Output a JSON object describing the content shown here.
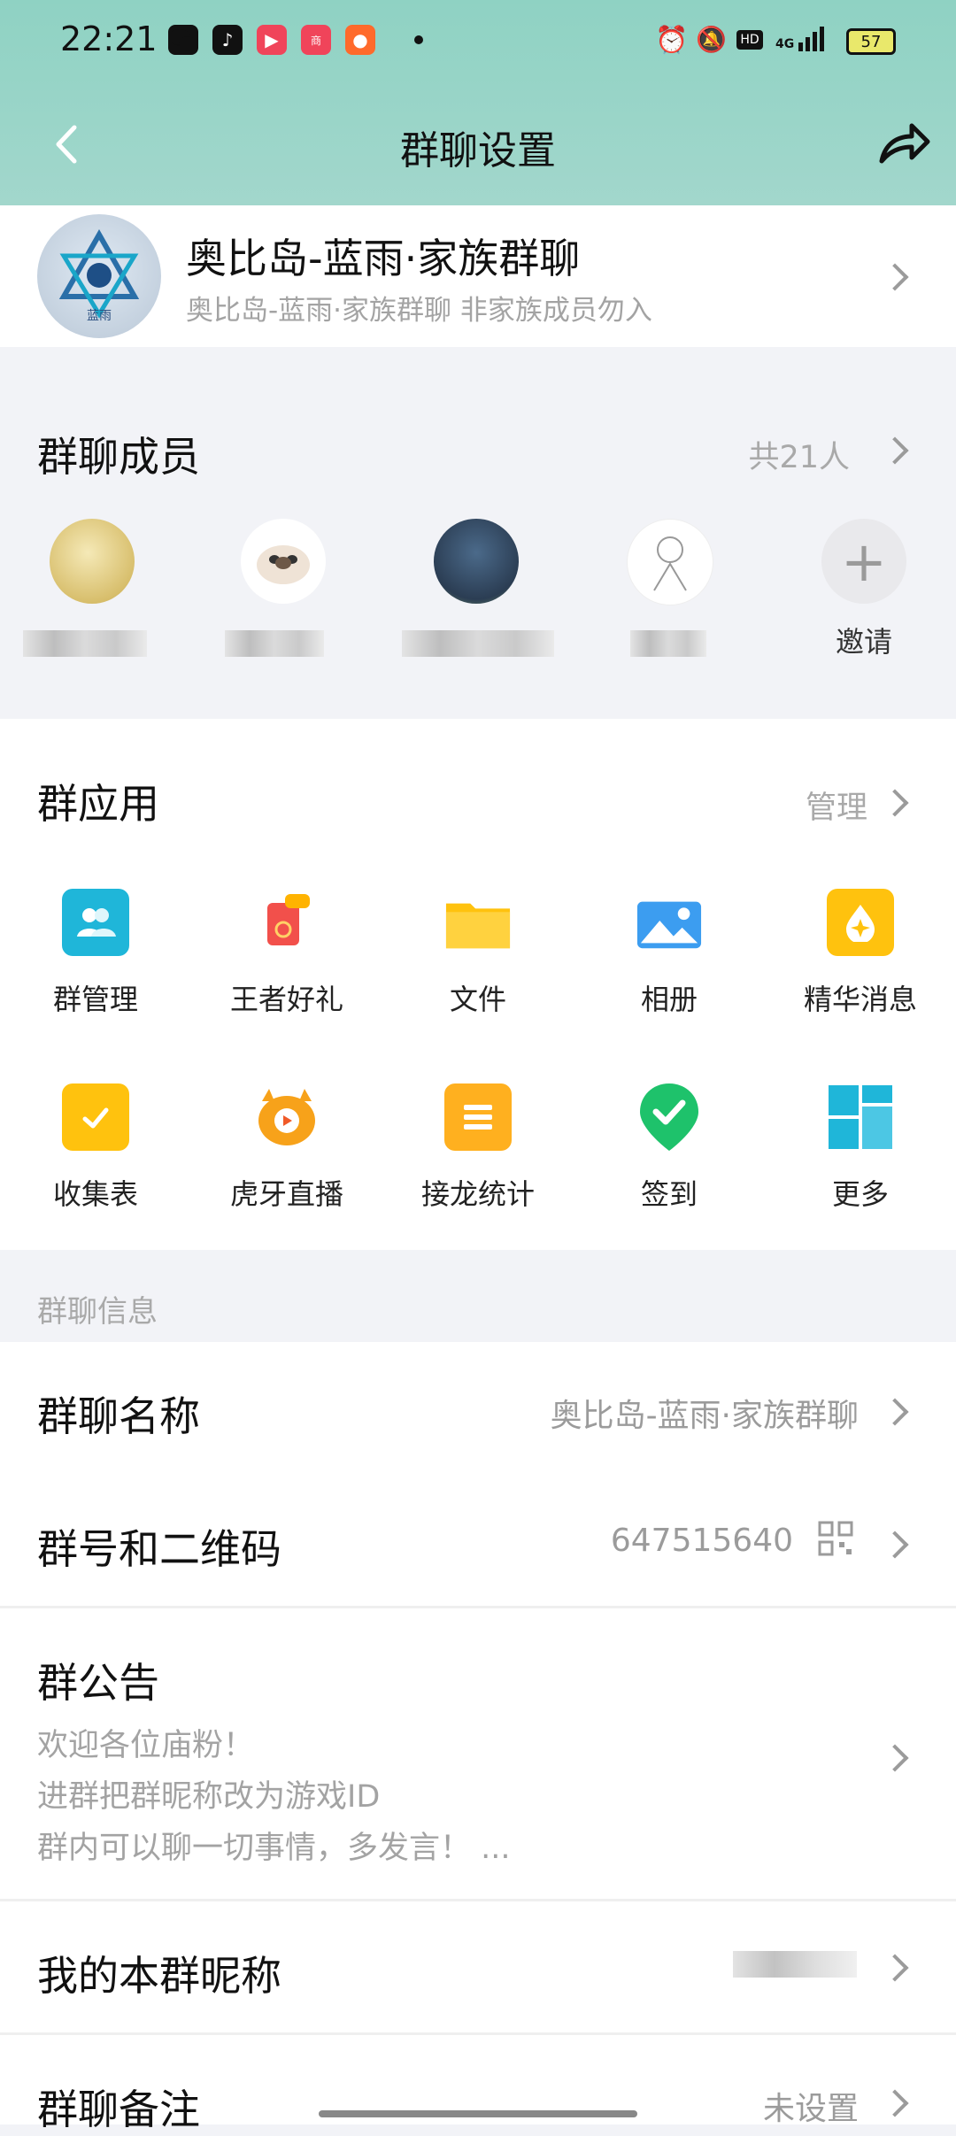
{
  "status_bar": {
    "time": "22:21",
    "battery": "57",
    "network": "4G"
  },
  "nav": {
    "title": "群聊设置"
  },
  "group": {
    "name": "奥比岛-蓝雨·家族群聊",
    "subtitle": "奥比岛-蓝雨·家族群聊 非家族成员勿入",
    "avatar_text": "蓝雨"
  },
  "members": {
    "title": "群聊成员",
    "count": "共21人",
    "invite_label": "邀请"
  },
  "apps": {
    "title": "群应用",
    "manage": "管理",
    "items": [
      {
        "label": "群管理",
        "icon": "group-manage-icon",
        "color": "#1fb6d9"
      },
      {
        "label": "王者好礼",
        "icon": "gift-icon",
        "color": "#f2504b"
      },
      {
        "label": "文件",
        "icon": "folder-icon",
        "color": "#ffc20e"
      },
      {
        "label": "相册",
        "icon": "album-icon",
        "color": "#3c9df0"
      },
      {
        "label": "精华消息",
        "icon": "essence-icon",
        "color": "#ffc20e"
      },
      {
        "label": "收集表",
        "icon": "form-icon",
        "color": "#ffc20e"
      },
      {
        "label": "虎牙直播",
        "icon": "huya-icon",
        "color": "#f7a21a"
      },
      {
        "label": "接龙统计",
        "icon": "list-icon",
        "color": "#ffb01f"
      },
      {
        "label": "签到",
        "icon": "checkin-icon",
        "color": "#1ec26b"
      },
      {
        "label": "更多",
        "icon": "grid-icon",
        "color": "#1fb6d9"
      }
    ]
  },
  "info": {
    "section_title": "群聊信息",
    "name_title": "群聊名称",
    "name_value": "奥比岛-蓝雨·家族群聊",
    "number_title": "群号和二维码",
    "number_value": "647515640",
    "notice_title": "群公告",
    "notice_lines": [
      "欢迎各位庙粉！",
      "进群把群昵称改为游戏ID",
      "群内可以聊一切事情，多发言！ ..."
    ],
    "nickname_title": "我的本群昵称",
    "remark_title": "群聊备注",
    "remark_value": "未设置"
  }
}
